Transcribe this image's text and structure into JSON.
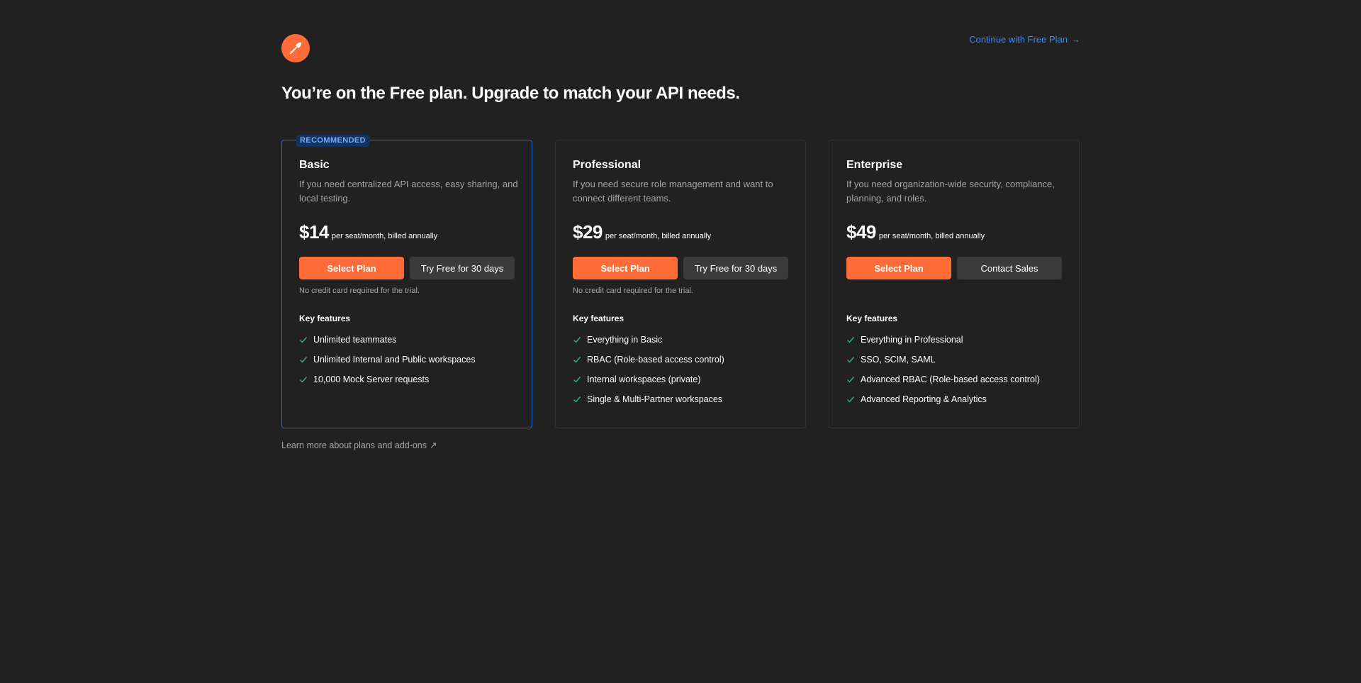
{
  "header": {
    "continue_link": "Continue with Free Plan",
    "headline": "You’re on the Free plan. Upgrade to match your API needs."
  },
  "colors": {
    "background": "#212121",
    "accent": "#ff6c37",
    "link": "#3d8bff",
    "recommended_border": "#1f6bd6",
    "check": "#2fb380"
  },
  "plans": [
    {
      "badge": "RECOMMENDED",
      "name": "Basic",
      "description": "If you need centralized API access, easy sharing, and local testing.",
      "price": "$14",
      "price_note": "per seat/month, billed annually",
      "primary_button": "Select Plan",
      "secondary_button": "Try Free for 30 days",
      "trial_note": "No credit card required for the trial.",
      "features_title": "Key features",
      "features": [
        "Unlimited teammates",
        "Unlimited Internal and Public workspaces",
        "10,000 Mock Server requests"
      ]
    },
    {
      "name": "Professional",
      "description": "If you need secure role management and want to connect different teams.",
      "price": "$29",
      "price_note": "per seat/month, billed annually",
      "primary_button": "Select Plan",
      "secondary_button": "Try Free for 30 days",
      "trial_note": "No credit card required for the trial.",
      "features_title": "Key features",
      "features": [
        "Everything in Basic",
        "RBAC (Role-based access control)",
        "Internal workspaces (private)",
        "Single & Multi-Partner workspaces"
      ]
    },
    {
      "name": "Enterprise",
      "description": "If you need organization-wide security, compliance, planning, and roles.",
      "price": "$49",
      "price_note": "per seat/month, billed annually",
      "primary_button": "Select Plan",
      "secondary_button": "Contact Sales",
      "features_title": "Key features",
      "features": [
        "Everything in Professional",
        "SSO, SCIM, SAML",
        "Advanced RBAC (Role-based access control)",
        "Advanced Reporting & Analytics"
      ]
    }
  ],
  "footer": {
    "learn_more": "Learn more about plans and add-ons"
  }
}
